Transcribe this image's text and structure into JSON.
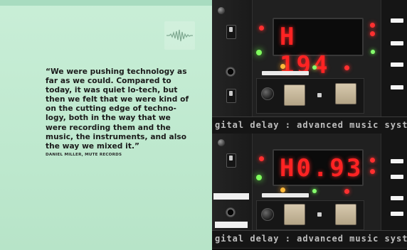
{
  "left_page": {
    "quote": "“We were pushing technology as far as we could. Compared to today, it was quiet lo-tech, but then we felt that we were kind of on the cutting edge of techno­logy, both in the way that we were recording them and the music, the instruments, and also the way we mixed it.”",
    "attribution": "DANIEL MILLER, MUTE RECORDS"
  },
  "devices": {
    "top_unit": {
      "display_value": "H 194",
      "brand_strip": "gital delay : advanced music systems : burnl"
    },
    "bottom_unit": {
      "display_value": "H0.93",
      "brand_strip": "gital delay : advanced music systems : burnl"
    }
  },
  "colors": {
    "mint_panel": "#c5ecd5",
    "led_red": "#ff2323",
    "led_green": "#80ff5d",
    "button_beige": "#c8b99b",
    "rack_black": "#151515"
  },
  "icons": {
    "wave_badge": "waveform-icon"
  }
}
